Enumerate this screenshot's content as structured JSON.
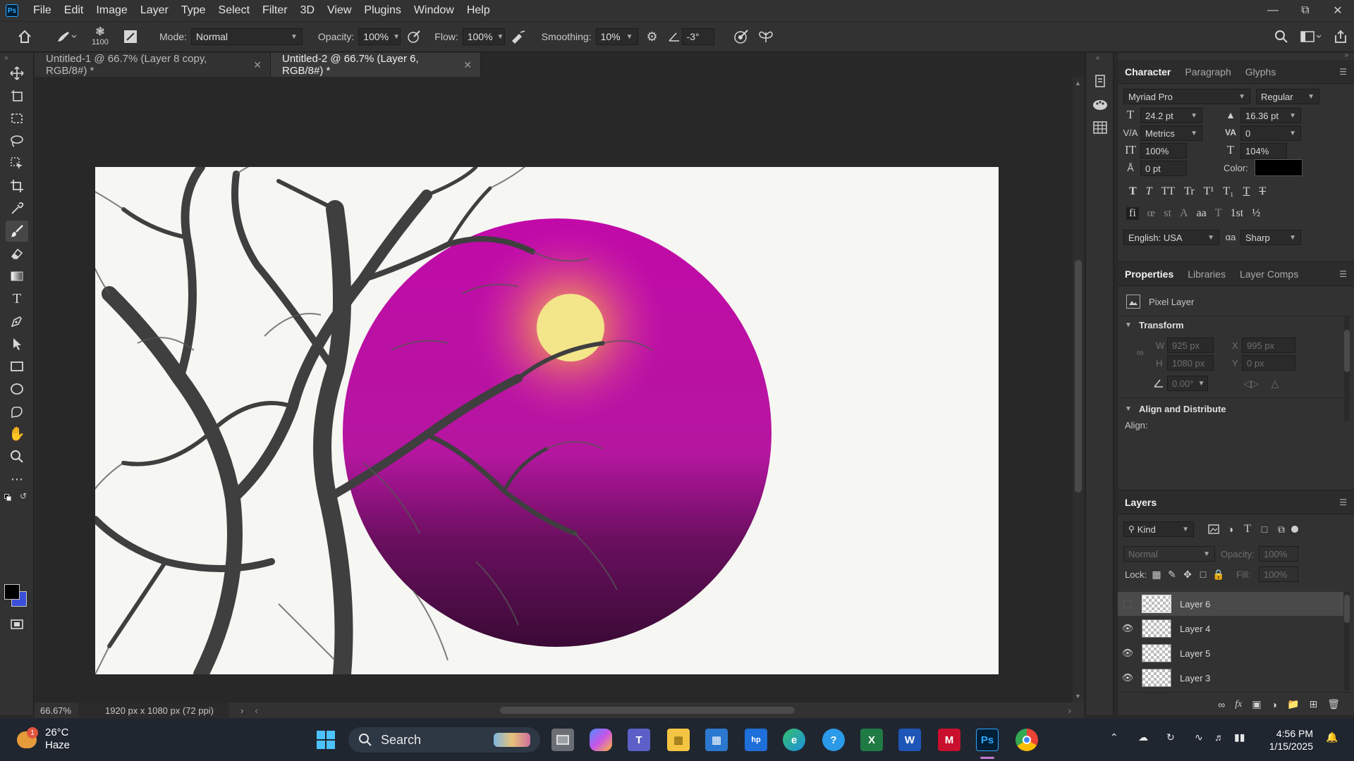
{
  "app": {
    "logo": "Ps",
    "menu": [
      "File",
      "Edit",
      "Image",
      "Layer",
      "Type",
      "Select",
      "Filter",
      "3D",
      "View",
      "Plugins",
      "Window",
      "Help"
    ]
  },
  "options": {
    "brush_size": "1100",
    "mode_label": "Mode:",
    "mode_value": "Normal",
    "opacity_label": "Opacity:",
    "opacity_value": "100%",
    "flow_label": "Flow:",
    "flow_value": "100%",
    "smoothing_label": "Smoothing:",
    "smoothing_value": "10%",
    "angle_value": "-3°"
  },
  "tabs": [
    {
      "label": "Untitled-1 @ 66.7% (Layer 8 copy, RGB/8#) *",
      "active": false
    },
    {
      "label": "Untitled-2 @ 66.7% (Layer 6, RGB/8#) *",
      "active": true
    }
  ],
  "status": {
    "zoom": "66.67%",
    "doc_info": "1920 px x 1080 px (72 ppi)"
  },
  "character": {
    "tabs": [
      "Character",
      "Paragraph",
      "Glyphs"
    ],
    "font_family": "Myriad Pro",
    "font_style": "Regular",
    "font_size": "24.2 pt",
    "leading": "16.36 pt",
    "kerning": "Metrics",
    "tracking": "0",
    "vertical_scale": "100%",
    "horizontal_scale": "104%",
    "baseline_shift": "0 pt",
    "color_label": "Color:",
    "color_value": "#000000",
    "language": "English: USA",
    "antialias": "Sharp"
  },
  "properties": {
    "tabs": [
      "Properties",
      "Libraries",
      "Layer Comps"
    ],
    "layer_type": "Pixel Layer",
    "transform_title": "Transform",
    "w_label": "W",
    "w_value": "925 px",
    "x_label": "X",
    "x_value": "995 px",
    "h_label": "H",
    "h_value": "1080 px",
    "y_label": "Y",
    "y_value": "0 px",
    "angle_value": "0.00°",
    "align_title": "Align and Distribute",
    "align_label": "Align:"
  },
  "layers": {
    "title": "Layers",
    "kind": "Kind",
    "blend": "Normal",
    "opacity_label": "Opacity:",
    "opacity_value": "100%",
    "lock_label": "Lock:",
    "fill_label": "Fill:",
    "fill_value": "100%",
    "items": [
      {
        "name": "Layer 6",
        "visible": false,
        "selected": true
      },
      {
        "name": "Layer 4",
        "visible": true,
        "selected": false
      },
      {
        "name": "Layer 5",
        "visible": true,
        "selected": false
      },
      {
        "name": "Layer 3",
        "visible": true,
        "selected": false
      }
    ]
  },
  "taskbar": {
    "weather_badge": "1",
    "temperature": "26°C",
    "weather": "Haze",
    "search": "Search",
    "time": "4:56 PM",
    "date": "1/15/2025"
  },
  "colors": {
    "accent": "#31a8ff",
    "circle_top": "#c10aa8",
    "circle_bottom": "#3a0a35",
    "sun": "#f3e58a",
    "foreground": "#000000",
    "background": "#3b4fd8"
  }
}
